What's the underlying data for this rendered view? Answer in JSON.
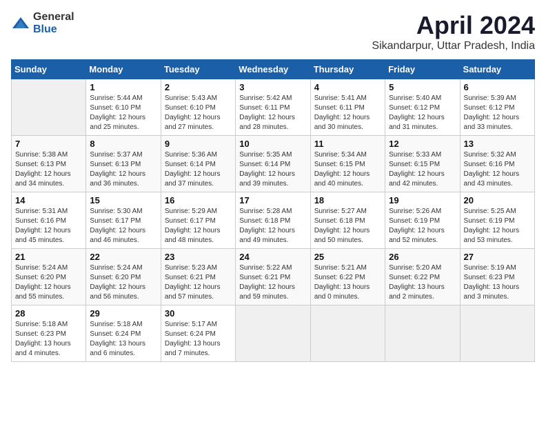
{
  "logo": {
    "general": "General",
    "blue": "Blue"
  },
  "header": {
    "title": "April 2024",
    "subtitle": "Sikandarpur, Uttar Pradesh, India"
  },
  "calendar": {
    "weekdays": [
      "Sunday",
      "Monday",
      "Tuesday",
      "Wednesday",
      "Thursday",
      "Friday",
      "Saturday"
    ],
    "weeks": [
      [
        {
          "day": "",
          "info": ""
        },
        {
          "day": "1",
          "info": "Sunrise: 5:44 AM\nSunset: 6:10 PM\nDaylight: 12 hours\nand 25 minutes."
        },
        {
          "day": "2",
          "info": "Sunrise: 5:43 AM\nSunset: 6:10 PM\nDaylight: 12 hours\nand 27 minutes."
        },
        {
          "day": "3",
          "info": "Sunrise: 5:42 AM\nSunset: 6:11 PM\nDaylight: 12 hours\nand 28 minutes."
        },
        {
          "day": "4",
          "info": "Sunrise: 5:41 AM\nSunset: 6:11 PM\nDaylight: 12 hours\nand 30 minutes."
        },
        {
          "day": "5",
          "info": "Sunrise: 5:40 AM\nSunset: 6:12 PM\nDaylight: 12 hours\nand 31 minutes."
        },
        {
          "day": "6",
          "info": "Sunrise: 5:39 AM\nSunset: 6:12 PM\nDaylight: 12 hours\nand 33 minutes."
        }
      ],
      [
        {
          "day": "7",
          "info": "Sunrise: 5:38 AM\nSunset: 6:13 PM\nDaylight: 12 hours\nand 34 minutes."
        },
        {
          "day": "8",
          "info": "Sunrise: 5:37 AM\nSunset: 6:13 PM\nDaylight: 12 hours\nand 36 minutes."
        },
        {
          "day": "9",
          "info": "Sunrise: 5:36 AM\nSunset: 6:14 PM\nDaylight: 12 hours\nand 37 minutes."
        },
        {
          "day": "10",
          "info": "Sunrise: 5:35 AM\nSunset: 6:14 PM\nDaylight: 12 hours\nand 39 minutes."
        },
        {
          "day": "11",
          "info": "Sunrise: 5:34 AM\nSunset: 6:15 PM\nDaylight: 12 hours\nand 40 minutes."
        },
        {
          "day": "12",
          "info": "Sunrise: 5:33 AM\nSunset: 6:15 PM\nDaylight: 12 hours\nand 42 minutes."
        },
        {
          "day": "13",
          "info": "Sunrise: 5:32 AM\nSunset: 6:16 PM\nDaylight: 12 hours\nand 43 minutes."
        }
      ],
      [
        {
          "day": "14",
          "info": "Sunrise: 5:31 AM\nSunset: 6:16 PM\nDaylight: 12 hours\nand 45 minutes."
        },
        {
          "day": "15",
          "info": "Sunrise: 5:30 AM\nSunset: 6:17 PM\nDaylight: 12 hours\nand 46 minutes."
        },
        {
          "day": "16",
          "info": "Sunrise: 5:29 AM\nSunset: 6:17 PM\nDaylight: 12 hours\nand 48 minutes."
        },
        {
          "day": "17",
          "info": "Sunrise: 5:28 AM\nSunset: 6:18 PM\nDaylight: 12 hours\nand 49 minutes."
        },
        {
          "day": "18",
          "info": "Sunrise: 5:27 AM\nSunset: 6:18 PM\nDaylight: 12 hours\nand 50 minutes."
        },
        {
          "day": "19",
          "info": "Sunrise: 5:26 AM\nSunset: 6:19 PM\nDaylight: 12 hours\nand 52 minutes."
        },
        {
          "day": "20",
          "info": "Sunrise: 5:25 AM\nSunset: 6:19 PM\nDaylight: 12 hours\nand 53 minutes."
        }
      ],
      [
        {
          "day": "21",
          "info": "Sunrise: 5:24 AM\nSunset: 6:20 PM\nDaylight: 12 hours\nand 55 minutes."
        },
        {
          "day": "22",
          "info": "Sunrise: 5:24 AM\nSunset: 6:20 PM\nDaylight: 12 hours\nand 56 minutes."
        },
        {
          "day": "23",
          "info": "Sunrise: 5:23 AM\nSunset: 6:21 PM\nDaylight: 12 hours\nand 57 minutes."
        },
        {
          "day": "24",
          "info": "Sunrise: 5:22 AM\nSunset: 6:21 PM\nDaylight: 12 hours\nand 59 minutes."
        },
        {
          "day": "25",
          "info": "Sunrise: 5:21 AM\nSunset: 6:22 PM\nDaylight: 13 hours\nand 0 minutes."
        },
        {
          "day": "26",
          "info": "Sunrise: 5:20 AM\nSunset: 6:22 PM\nDaylight: 13 hours\nand 2 minutes."
        },
        {
          "day": "27",
          "info": "Sunrise: 5:19 AM\nSunset: 6:23 PM\nDaylight: 13 hours\nand 3 minutes."
        }
      ],
      [
        {
          "day": "28",
          "info": "Sunrise: 5:18 AM\nSunset: 6:23 PM\nDaylight: 13 hours\nand 4 minutes."
        },
        {
          "day": "29",
          "info": "Sunrise: 5:18 AM\nSunset: 6:24 PM\nDaylight: 13 hours\nand 6 minutes."
        },
        {
          "day": "30",
          "info": "Sunrise: 5:17 AM\nSunset: 6:24 PM\nDaylight: 13 hours\nand 7 minutes."
        },
        {
          "day": "",
          "info": ""
        },
        {
          "day": "",
          "info": ""
        },
        {
          "day": "",
          "info": ""
        },
        {
          "day": "",
          "info": ""
        }
      ]
    ]
  }
}
